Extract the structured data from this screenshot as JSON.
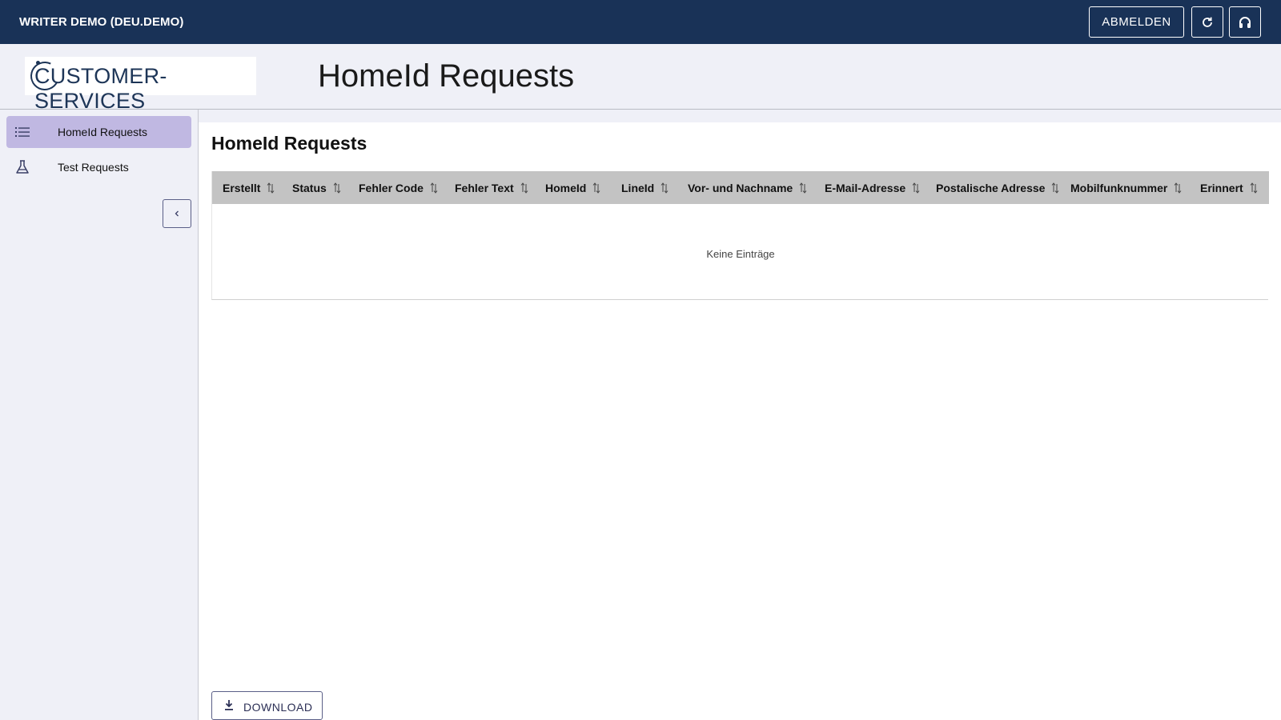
{
  "topbar": {
    "app_title": "WRITER DEMO (DEU.DEMO)",
    "logout_label": "ABMELDEN",
    "refresh_icon": "refresh-icon",
    "support_icon": "headset-icon",
    "bg_color": "#193257"
  },
  "header": {
    "logo_text": "CUSTOMER-SERVICES",
    "page_title": "HomeId Requests"
  },
  "sidebar": {
    "items": [
      {
        "label": "HomeId Requests",
        "icon": "list-icon",
        "active": true
      },
      {
        "label": "Test Requests",
        "icon": "flask-icon",
        "active": false
      }
    ],
    "collapse_icon": "chevron-left-icon",
    "active_color": "#c0b8e2"
  },
  "main": {
    "section_title": "HomeId Requests",
    "table": {
      "columns": [
        "Erstellt",
        "Status",
        "Fehler Code",
        "Fehler Text",
        "HomeId",
        "LineId",
        "Vor- und Nachname",
        "E-Mail-Adresse",
        "Postalische Adresse",
        "Mobilfunknummer",
        "Erinnert"
      ],
      "rows": [],
      "empty_message": "Keine Einträge"
    },
    "download_label": "DOWNLOAD"
  }
}
